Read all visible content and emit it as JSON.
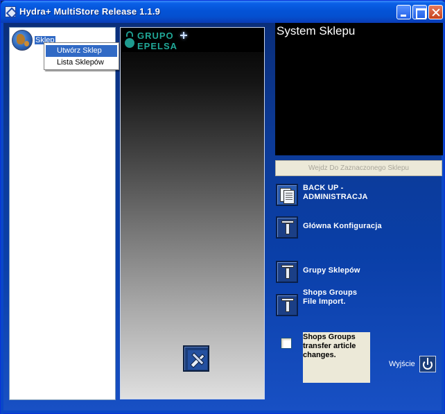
{
  "window": {
    "title": "Hydra+ MultiStore Release 1.1.9",
    "colors": {
      "title_bar": "#0a5fe7",
      "client_bg": "#0c3a96",
      "selection": "#316ac5"
    }
  },
  "tree": {
    "root_label": "Sklep",
    "root_icon": "globe-icon"
  },
  "context_menu": {
    "items": [
      {
        "label": "Utwórz Sklep",
        "selected": true
      },
      {
        "label": "Lista Sklepów",
        "selected": false
      }
    ]
  },
  "logo": {
    "line1": "GRUPO",
    "line2": "EPELSA",
    "color": "#20a898"
  },
  "middle_panel": {
    "action_icon": "tools-icon"
  },
  "system": {
    "title": "System Sklepu",
    "enter_button": "Wejdz Do Zaznaczonego Sklepu"
  },
  "menu": {
    "backup_line1": "BACK UP  -",
    "backup_line2": "ADMINISTRACJA",
    "main_config": "Główna Konfiguracja",
    "shop_groups": "Grupy Sklepów",
    "file_import_line1": "Shops Groups",
    "file_import_line2": "File Import."
  },
  "transfer": {
    "line1": "Shops Groups",
    "line2": "transfer article",
    "line3": "changes.",
    "checked": false
  },
  "exit": {
    "label": "Wyjście",
    "icon": "power-icon"
  }
}
